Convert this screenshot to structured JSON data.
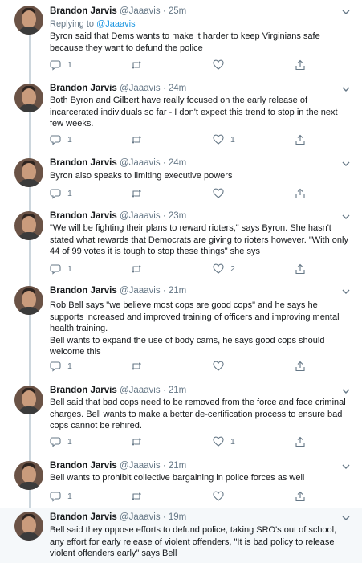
{
  "colors": {
    "accent": "#1b95e0",
    "muted": "#657786",
    "thread_line": "#ccd6dd",
    "highlight_bg": "#f5f8fa"
  },
  "icons": {
    "reply": "reply-icon",
    "retweet": "retweet-icon",
    "like": "heart-icon",
    "share": "share-icon",
    "menu": "chevron-down-icon"
  },
  "tweets": [
    {
      "author": "Brandon Jarvis",
      "handle": "@Jaaavis",
      "time": "· 25m",
      "reply_prefix": "Replying to",
      "reply_mention": "@Jaaavis",
      "text": "Byron said that Dems wants to make it harder to keep Virginians safe because they want to defund the police",
      "replies": "1",
      "retweets": "",
      "likes": ""
    },
    {
      "author": "Brandon Jarvis",
      "handle": "@Jaaavis",
      "time": "· 24m",
      "text": "Both Byron and Gilbert have really focused on the early release of incarcerated individuals so far - I don't expect this trend to stop in the next few weeks.",
      "replies": "1",
      "retweets": "",
      "likes": "1"
    },
    {
      "author": "Brandon Jarvis",
      "handle": "@Jaaavis",
      "time": "· 24m",
      "text": "Byron also speaks to limiting executive powers",
      "replies": "1",
      "retweets": "",
      "likes": ""
    },
    {
      "author": "Brandon Jarvis",
      "handle": "@Jaaavis",
      "time": "· 23m",
      "text": "\"We will be fighting their plans to reward rioters,\" says Byron. She hasn't stated what rewards that Democrats are giving to rioters however. \"With only 44 of 99 votes it is tough to stop these things\" she sys",
      "replies": "1",
      "retweets": "",
      "likes": "2"
    },
    {
      "author": "Brandon Jarvis",
      "handle": "@Jaaavis",
      "time": "· 21m",
      "text": "Rob Bell says \"we believe most cops are good cops\" and he says he supports increased and improved training of officers and improving mental health training.\nBell wants to expand the use of body cams, he says good cops should welcome this",
      "replies": "1",
      "retweets": "",
      "likes": ""
    },
    {
      "author": "Brandon Jarvis",
      "handle": "@Jaaavis",
      "time": "· 21m",
      "text": "Bell said that bad cops need to be removed from the force and face criminal charges. Bell wants to make a better de-certification process to ensure bad cops cannot be rehired.",
      "replies": "1",
      "retweets": "",
      "likes": "1"
    },
    {
      "author": "Brandon Jarvis",
      "handle": "@Jaaavis",
      "time": "· 21m",
      "text": "Bell wants to prohibit collective bargaining in police forces as well",
      "replies": "1",
      "retweets": "",
      "likes": ""
    },
    {
      "author": "Brandon Jarvis",
      "handle": "@Jaaavis",
      "time": "· 19m",
      "text": "Bell said they oppose efforts to defund police, taking SRO's out of school, any effort for early release of violent offenders, \"It is bad policy to release violent offenders early\" says Bell",
      "replies": "",
      "retweets": "",
      "likes": ""
    }
  ]
}
